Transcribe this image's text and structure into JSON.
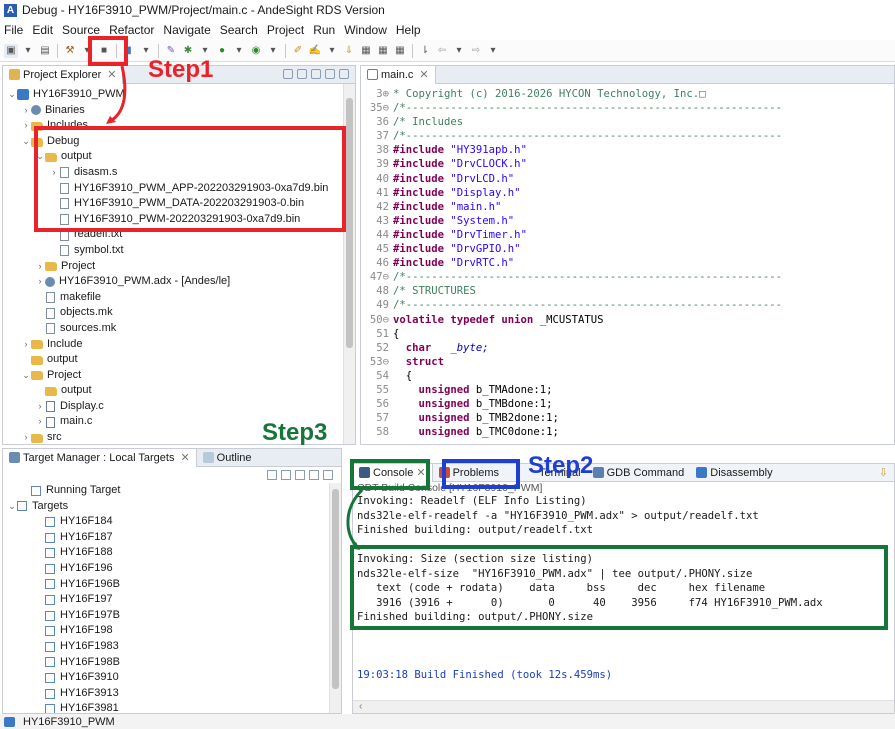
{
  "window": {
    "title": "Debug - HY16F3910_PWM/Project/main.c - AndeSight RDS Version"
  },
  "menu": [
    "File",
    "Edit",
    "Source",
    "Refactor",
    "Navigate",
    "Search",
    "Project",
    "Run",
    "Window",
    "Help"
  ],
  "project_explorer": {
    "tab_label": "Project Explorer",
    "rows": [
      {
        "indent": 0,
        "twisty": "v",
        "icon": "proj",
        "label": "HY16F3910_PWM"
      },
      {
        "indent": 1,
        "twisty": ">",
        "icon": "gear",
        "label": "Binaries"
      },
      {
        "indent": 1,
        "twisty": ">",
        "icon": "folder",
        "label": "Includes"
      },
      {
        "indent": 1,
        "twisty": "v",
        "icon": "folder",
        "label": "Debug"
      },
      {
        "indent": 2,
        "twisty": "v",
        "icon": "folder",
        "label": "output"
      },
      {
        "indent": 3,
        "twisty": ">",
        "icon": "file",
        "label": "disasm.s"
      },
      {
        "indent": 3,
        "twisty": "",
        "icon": "file",
        "label": "HY16F3910_PWM_APP-202203291903-0xa7d9.bin"
      },
      {
        "indent": 3,
        "twisty": "",
        "icon": "file",
        "label": "HY16F3910_PWM_DATA-202203291903-0.bin"
      },
      {
        "indent": 3,
        "twisty": "",
        "icon": "file",
        "label": "HY16F3910_PWM-202203291903-0xa7d9.bin"
      },
      {
        "indent": 3,
        "twisty": "",
        "icon": "file",
        "label": "readelf.txt"
      },
      {
        "indent": 3,
        "twisty": "",
        "icon": "file",
        "label": "symbol.txt"
      },
      {
        "indent": 2,
        "twisty": ">",
        "icon": "folder",
        "label": "Project"
      },
      {
        "indent": 2,
        "twisty": ">",
        "icon": "gear",
        "label": "HY16F3910_PWM.adx - [Andes/le]"
      },
      {
        "indent": 2,
        "twisty": "",
        "icon": "file",
        "label": "makefile"
      },
      {
        "indent": 2,
        "twisty": "",
        "icon": "file",
        "label": "objects.mk"
      },
      {
        "indent": 2,
        "twisty": "",
        "icon": "file",
        "label": "sources.mk"
      },
      {
        "indent": 1,
        "twisty": ">",
        "icon": "folder",
        "label": "Include"
      },
      {
        "indent": 1,
        "twisty": "",
        "icon": "folder",
        "label": "output"
      },
      {
        "indent": 1,
        "twisty": "v",
        "icon": "folder",
        "label": "Project"
      },
      {
        "indent": 2,
        "twisty": "",
        "icon": "folder",
        "label": "output"
      },
      {
        "indent": 2,
        "twisty": ">",
        "icon": "cfile",
        "label": "Display.c"
      },
      {
        "indent": 2,
        "twisty": ">",
        "icon": "cfile",
        "label": "main.c"
      },
      {
        "indent": 1,
        "twisty": ">",
        "icon": "folder",
        "label": "src"
      }
    ]
  },
  "editor": {
    "tab_label": "main.c",
    "lines": [
      {
        "n": "3⊕",
        "parts": [
          {
            "t": "* Copyright (c) 2016-2026 HYCON Technology, Inc.□",
            "c": "comment"
          }
        ]
      },
      {
        "n": "35⊖",
        "parts": [
          {
            "t": "/*-----------------------------------------------------------",
            "c": "comment"
          }
        ]
      },
      {
        "n": "36",
        "parts": [
          {
            "t": "/* Includes",
            "c": "comment"
          }
        ]
      },
      {
        "n": "37",
        "parts": [
          {
            "t": "/*-----------------------------------------------------------",
            "c": "comment"
          }
        ]
      },
      {
        "n": "38",
        "parts": [
          {
            "t": "#include ",
            "c": "kw"
          },
          {
            "t": "\"HY391apb.h\"",
            "c": "str"
          }
        ]
      },
      {
        "n": "39",
        "parts": [
          {
            "t": "#include ",
            "c": "kw"
          },
          {
            "t": "\"DrvCLOCK.h\"",
            "c": "str"
          }
        ]
      },
      {
        "n": "40",
        "parts": [
          {
            "t": "#include ",
            "c": "kw"
          },
          {
            "t": "\"DrvLCD.h\"",
            "c": "str"
          }
        ]
      },
      {
        "n": "41",
        "parts": [
          {
            "t": "#include ",
            "c": "kw"
          },
          {
            "t": "\"Display.h\"",
            "c": "str"
          }
        ]
      },
      {
        "n": "42",
        "parts": [
          {
            "t": "#include ",
            "c": "kw"
          },
          {
            "t": "\"main.h\"",
            "c": "str"
          }
        ]
      },
      {
        "n": "43",
        "parts": [
          {
            "t": "#include ",
            "c": "kw"
          },
          {
            "t": "\"System.h\"",
            "c": "str"
          }
        ]
      },
      {
        "n": "44",
        "parts": [
          {
            "t": "#include ",
            "c": "kw"
          },
          {
            "t": "\"DrvTimer.h\"",
            "c": "str"
          }
        ]
      },
      {
        "n": "45",
        "parts": [
          {
            "t": "#include ",
            "c": "kw"
          },
          {
            "t": "\"DrvGPIO.h\"",
            "c": "str"
          }
        ]
      },
      {
        "n": "46",
        "parts": [
          {
            "t": "#include ",
            "c": "kw"
          },
          {
            "t": "\"DrvRTC.h\"",
            "c": "str"
          }
        ]
      },
      {
        "n": "47⊖",
        "parts": [
          {
            "t": "/*-----------------------------------------------------------",
            "c": "comment"
          }
        ]
      },
      {
        "n": "48",
        "parts": [
          {
            "t": "/* STRUCTURES",
            "c": "comment"
          }
        ]
      },
      {
        "n": "49",
        "parts": [
          {
            "t": "/*-----------------------------------------------------------",
            "c": "comment"
          }
        ]
      },
      {
        "n": "50⊖",
        "parts": [
          {
            "t": "volatile typedef union ",
            "c": "kw"
          },
          {
            "t": "_MCUSTATUS",
            "c": "plain"
          }
        ]
      },
      {
        "n": "51",
        "parts": [
          {
            "t": "{",
            "c": "plain"
          }
        ]
      },
      {
        "n": "52",
        "parts": [
          {
            "t": "  char ",
            "c": "kw"
          },
          {
            "t": "  _byte;",
            "c": "ital"
          }
        ]
      },
      {
        "n": "53⊖",
        "parts": [
          {
            "t": "  struct",
            "c": "kw"
          }
        ]
      },
      {
        "n": "54",
        "parts": [
          {
            "t": "  {",
            "c": "plain"
          }
        ]
      },
      {
        "n": "55",
        "parts": [
          {
            "t": "    unsigned ",
            "c": "kw"
          },
          {
            "t": "b_TMAdone:1;",
            "c": "plain"
          }
        ]
      },
      {
        "n": "56",
        "parts": [
          {
            "t": "    unsigned ",
            "c": "kw"
          },
          {
            "t": "b_TMBdone:1;",
            "c": "plain"
          }
        ]
      },
      {
        "n": "57",
        "parts": [
          {
            "t": "    unsigned ",
            "c": "kw"
          },
          {
            "t": "b_TMB2done:1;",
            "c": "plain"
          }
        ]
      },
      {
        "n": "58",
        "parts": [
          {
            "t": "    unsigned ",
            "c": "kw"
          },
          {
            "t": "b_TMC0done:1;",
            "c": "plain"
          }
        ]
      }
    ]
  },
  "target_manager": {
    "tab_label": "Target Manager : Local Targets",
    "outline_label": "Outline",
    "rows": [
      {
        "indent": 1,
        "twisty": "",
        "icon": "chip",
        "label": "Running Target"
      },
      {
        "indent": 0,
        "twisty": "v",
        "icon": "chip",
        "label": "Targets"
      },
      {
        "indent": 2,
        "twisty": "",
        "icon": "chip",
        "label": "HY16F184"
      },
      {
        "indent": 2,
        "twisty": "",
        "icon": "chip",
        "label": "HY16F187"
      },
      {
        "indent": 2,
        "twisty": "",
        "icon": "chip",
        "label": "HY16F188"
      },
      {
        "indent": 2,
        "twisty": "",
        "icon": "chip",
        "label": "HY16F196"
      },
      {
        "indent": 2,
        "twisty": "",
        "icon": "chip",
        "label": "HY16F196B"
      },
      {
        "indent": 2,
        "twisty": "",
        "icon": "chip",
        "label": "HY16F197"
      },
      {
        "indent": 2,
        "twisty": "",
        "icon": "chip",
        "label": "HY16F197B"
      },
      {
        "indent": 2,
        "twisty": "",
        "icon": "chip",
        "label": "HY16F198"
      },
      {
        "indent": 2,
        "twisty": "",
        "icon": "chip",
        "label": "HY16F1983"
      },
      {
        "indent": 2,
        "twisty": "",
        "icon": "chip",
        "label": "HY16F198B"
      },
      {
        "indent": 2,
        "twisty": "",
        "icon": "chip",
        "label": "HY16F3910"
      },
      {
        "indent": 2,
        "twisty": "",
        "icon": "chip",
        "label": "HY16F3913"
      },
      {
        "indent": 2,
        "twisty": "",
        "icon": "chip",
        "label": "HY16F3981"
      }
    ]
  },
  "bottom_tabs": {
    "console": "Console",
    "problems": "Problems",
    "terminal": "Terminal",
    "gdb": "GDB Command",
    "disassembly": "Disassembly",
    "console_title": "CDT Build Console [HY16F3910_PWM]"
  },
  "console_lines": [
    "Invoking: Readelf (ELF Info Listing)",
    "nds32le-elf-readelf -a \"HY16F3910_PWM.adx\" > output/readelf.txt",
    "Finished building: output/readelf.txt",
    "",
    "Invoking: Size (section size listing)",
    "nds32le-elf-size  \"HY16F3910_PWM.adx\" | tee output/.PHONY.size",
    "   text (code + rodata)    data     bss     dec     hex filename",
    "   3916 (3916 +      0)       0      40    3956     f74 HY16F3910_PWM.adx",
    "Finished building: output/.PHONY.size",
    "",
    "",
    "",
    "19:03:18 Build Finished (took 12s.459ms)"
  ],
  "status": {
    "label": "HY16F3910_PWM"
  },
  "annotations": {
    "step1": "Step1",
    "step2": "Step2",
    "step3": "Step3"
  },
  "colors": {
    "red": "#e8232a",
    "blue": "#1f3fcf",
    "green": "#16763a"
  }
}
